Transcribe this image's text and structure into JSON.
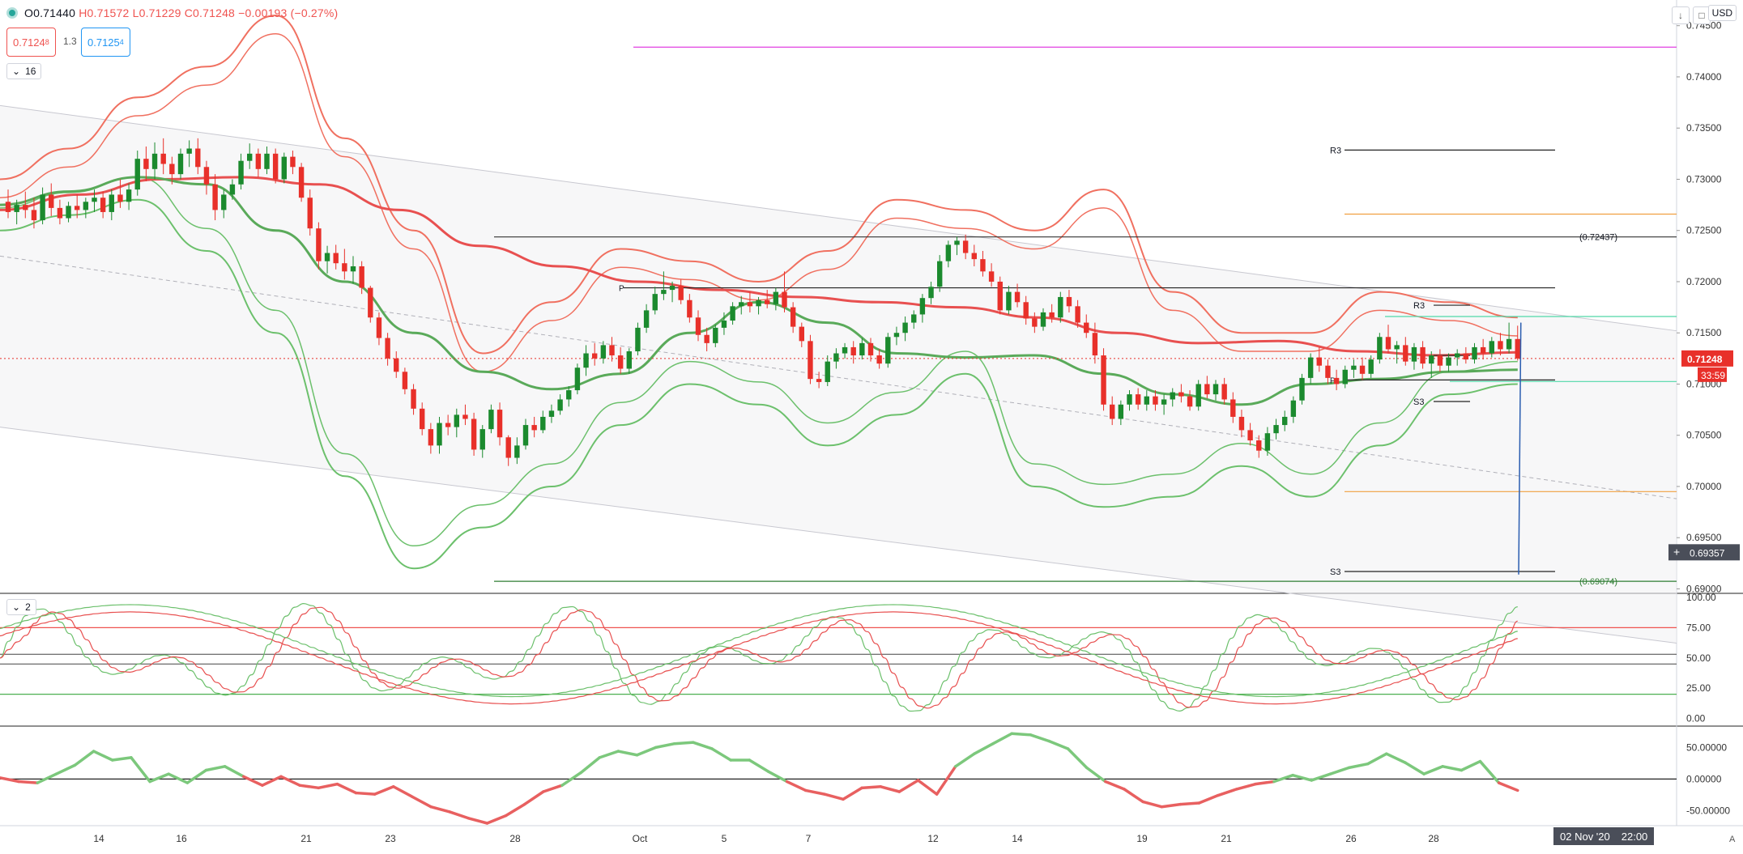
{
  "header": {
    "ohlc_open": "O0.71440",
    "ohlc_high": "H0.71572",
    "ohlc_low": "L0.71229",
    "ohlc_close": "C0.71248",
    "ohlc_change": "−0.00193 (−0.27%)",
    "sell_price": "0.7124",
    "sell_price_sup": "8",
    "spread": "1.3",
    "buy_price": "0.7125",
    "buy_price_sup": "4",
    "indicator_count_main": "16",
    "indicator_count_sub": "2",
    "currency": "USD"
  },
  "colors": {
    "up": "#1b8a2e",
    "down": "#e8302a",
    "bb_upper": "#f07060",
    "bb_lower": "#6cc06c",
    "ma_slow": "#e85050",
    "ma_fast": "#5aaa5a",
    "magenta": "#e040e0",
    "orange": "#f0a040",
    "mint": "#50d8a8",
    "trend_blue": "#2a5db0",
    "price_tag": "#e8302a",
    "crosshair_tag": "#4a4e59"
  },
  "price_axis": {
    "ticks": [
      "0.74500",
      "0.74000",
      "0.73500",
      "0.73000",
      "0.72500",
      "0.72000",
      "0.71500",
      "0.71000",
      "0.70500",
      "0.70000",
      "0.69500",
      "0.69000"
    ],
    "current_price": "0.71248",
    "countdown": "33:59",
    "crosshair_price": "0.69357"
  },
  "stoch_axis": {
    "ticks": [
      "100.00",
      "75.00",
      "50.00",
      "25.00",
      "0.00"
    ]
  },
  "mom_axis": {
    "ticks": [
      "50.00000",
      "0.00000",
      "-50.00000"
    ]
  },
  "time_axis": {
    "labels": [
      "14",
      "16",
      "21",
      "23",
      "28",
      "Oct",
      "5",
      "7",
      "12",
      "14",
      "19",
      "21",
      "26",
      "28"
    ],
    "tail": "4",
    "crosshair_date": "02 Nov '20",
    "crosshair_time": "22:00"
  },
  "annotations": {
    "fib_high": "(0.72437)",
    "fib_low": "(0.69074)",
    "r3_weekly": "R3",
    "s3_weekly": "S3",
    "r3_daily": "R3",
    "s3_daily": "S3",
    "p_label": "P",
    "p_label2": "P"
  },
  "chart_data": {
    "type": "candlestick",
    "symbol_pair": "AUD/USD",
    "ylim": [
      0.6898,
      0.7464
    ],
    "candles": [
      [
        0.7278,
        0.729,
        0.7262,
        0.7268
      ],
      [
        0.7268,
        0.728,
        0.7256,
        0.7275
      ],
      [
        0.7275,
        0.7288,
        0.7262,
        0.727
      ],
      [
        0.727,
        0.7282,
        0.7252,
        0.726
      ],
      [
        0.726,
        0.7292,
        0.7256,
        0.7285
      ],
      [
        0.7285,
        0.7296,
        0.7264,
        0.7272
      ],
      [
        0.7272,
        0.728,
        0.7256,
        0.7262
      ],
      [
        0.7262,
        0.7278,
        0.7258,
        0.7274
      ],
      [
        0.7274,
        0.7285,
        0.7262,
        0.727
      ],
      [
        0.727,
        0.7282,
        0.7262,
        0.7278
      ],
      [
        0.7278,
        0.729,
        0.7268,
        0.7282
      ],
      [
        0.7282,
        0.7288,
        0.7262,
        0.7268
      ],
      [
        0.7268,
        0.729,
        0.726,
        0.7285
      ],
      [
        0.7285,
        0.73,
        0.7272,
        0.7278
      ],
      [
        0.7278,
        0.7296,
        0.727,
        0.729
      ],
      [
        0.729,
        0.7328,
        0.7284,
        0.732
      ],
      [
        0.732,
        0.7332,
        0.7298,
        0.731
      ],
      [
        0.731,
        0.7336,
        0.73,
        0.7325
      ],
      [
        0.7325,
        0.734,
        0.7305,
        0.7315
      ],
      [
        0.7315,
        0.7322,
        0.7295,
        0.7305
      ],
      [
        0.7305,
        0.733,
        0.73,
        0.7325
      ],
      [
        0.7325,
        0.7338,
        0.7312,
        0.733
      ],
      [
        0.733,
        0.734,
        0.7305,
        0.7312
      ],
      [
        0.7312,
        0.7318,
        0.7285,
        0.7295
      ],
      [
        0.7295,
        0.7305,
        0.726,
        0.727
      ],
      [
        0.727,
        0.729,
        0.7262,
        0.7285
      ],
      [
        0.7285,
        0.73,
        0.728,
        0.7295
      ],
      [
        0.7295,
        0.7325,
        0.729,
        0.7318
      ],
      [
        0.7318,
        0.7335,
        0.731,
        0.7325
      ],
      [
        0.7325,
        0.733,
        0.7302,
        0.731
      ],
      [
        0.731,
        0.7332,
        0.7305,
        0.7325
      ],
      [
        0.7325,
        0.733,
        0.7296,
        0.73
      ],
      [
        0.73,
        0.7326,
        0.7296,
        0.7322
      ],
      [
        0.7322,
        0.7328,
        0.7305,
        0.7312
      ],
      [
        0.7312,
        0.7316,
        0.7278,
        0.7282
      ],
      [
        0.7282,
        0.729,
        0.7245,
        0.7252
      ],
      [
        0.7252,
        0.7258,
        0.7212,
        0.722
      ],
      [
        0.722,
        0.7235,
        0.7208,
        0.7228
      ],
      [
        0.7228,
        0.7236,
        0.7212,
        0.7218
      ],
      [
        0.7218,
        0.7232,
        0.7202,
        0.721
      ],
      [
        0.721,
        0.7225,
        0.7198,
        0.7215
      ],
      [
        0.7215,
        0.722,
        0.7188,
        0.7194
      ],
      [
        0.7194,
        0.7196,
        0.716,
        0.7165
      ],
      [
        0.7165,
        0.717,
        0.7138,
        0.7145
      ],
      [
        0.7145,
        0.715,
        0.7118,
        0.7125
      ],
      [
        0.7125,
        0.7132,
        0.7106,
        0.7112
      ],
      [
        0.7112,
        0.7116,
        0.709,
        0.7095
      ],
      [
        0.7095,
        0.71,
        0.707,
        0.7076
      ],
      [
        0.7076,
        0.7082,
        0.705,
        0.7056
      ],
      [
        0.7056,
        0.7062,
        0.7032,
        0.704
      ],
      [
        0.704,
        0.7068,
        0.7032,
        0.7062
      ],
      [
        0.7062,
        0.707,
        0.705,
        0.7058
      ],
      [
        0.7058,
        0.7076,
        0.7048,
        0.707
      ],
      [
        0.707,
        0.708,
        0.706,
        0.7066
      ],
      [
        0.7066,
        0.7072,
        0.703,
        0.7036
      ],
      [
        0.7036,
        0.706,
        0.7028,
        0.7056
      ],
      [
        0.7056,
        0.708,
        0.7052,
        0.7075
      ],
      [
        0.7075,
        0.7082,
        0.704,
        0.7048
      ],
      [
        0.7048,
        0.705,
        0.702,
        0.7028
      ],
      [
        0.7028,
        0.7048,
        0.7022,
        0.704
      ],
      [
        0.704,
        0.7066,
        0.7036,
        0.706
      ],
      [
        0.706,
        0.7068,
        0.7048,
        0.7055
      ],
      [
        0.7055,
        0.7074,
        0.7052,
        0.7068
      ],
      [
        0.7068,
        0.708,
        0.7062,
        0.7074
      ],
      [
        0.7074,
        0.709,
        0.707,
        0.7085
      ],
      [
        0.7085,
        0.7098,
        0.7078,
        0.7094
      ],
      [
        0.7094,
        0.712,
        0.709,
        0.7116
      ],
      [
        0.7116,
        0.7138,
        0.7108,
        0.713
      ],
      [
        0.713,
        0.714,
        0.7118,
        0.7125
      ],
      [
        0.7125,
        0.7142,
        0.712,
        0.7138
      ],
      [
        0.7138,
        0.7146,
        0.7122,
        0.7128
      ],
      [
        0.7128,
        0.7136,
        0.711,
        0.7115
      ],
      [
        0.7115,
        0.7135,
        0.711,
        0.7132
      ],
      [
        0.7132,
        0.716,
        0.7128,
        0.7155
      ],
      [
        0.7155,
        0.7178,
        0.715,
        0.7172
      ],
      [
        0.7172,
        0.7195,
        0.7168,
        0.7188
      ],
      [
        0.7188,
        0.721,
        0.7182,
        0.7192
      ],
      [
        0.7192,
        0.72,
        0.718,
        0.7196
      ],
      [
        0.7196,
        0.7202,
        0.7178,
        0.7182
      ],
      [
        0.7182,
        0.7188,
        0.716,
        0.7165
      ],
      [
        0.7165,
        0.7172,
        0.7142,
        0.7148
      ],
      [
        0.7148,
        0.7155,
        0.7132,
        0.714
      ],
      [
        0.714,
        0.7158,
        0.7136,
        0.7155
      ],
      [
        0.7155,
        0.717,
        0.7148,
        0.7162
      ],
      [
        0.7162,
        0.718,
        0.7158,
        0.7176
      ],
      [
        0.7176,
        0.7186,
        0.7168,
        0.718
      ],
      [
        0.718,
        0.719,
        0.717,
        0.7176
      ],
      [
        0.7176,
        0.7185,
        0.7168,
        0.7182
      ],
      [
        0.7182,
        0.7192,
        0.7174,
        0.7178
      ],
      [
        0.7178,
        0.7194,
        0.7172,
        0.719
      ],
      [
        0.719,
        0.721,
        0.717,
        0.7175
      ],
      [
        0.7175,
        0.718,
        0.715,
        0.7156
      ],
      [
        0.7156,
        0.716,
        0.7136,
        0.7142
      ],
      [
        0.7142,
        0.7148,
        0.71,
        0.7105
      ],
      [
        0.7105,
        0.7112,
        0.7096,
        0.7102
      ],
      [
        0.7102,
        0.7128,
        0.7098,
        0.7122
      ],
      [
        0.7122,
        0.7135,
        0.7115,
        0.713
      ],
      [
        0.713,
        0.714,
        0.7125,
        0.7136
      ],
      [
        0.7136,
        0.7142,
        0.712,
        0.7128
      ],
      [
        0.7128,
        0.7145,
        0.7124,
        0.714
      ],
      [
        0.714,
        0.7145,
        0.7122,
        0.7128
      ],
      [
        0.7128,
        0.7134,
        0.7115,
        0.712
      ],
      [
        0.712,
        0.715,
        0.7116,
        0.7146
      ],
      [
        0.7146,
        0.7156,
        0.7138,
        0.715
      ],
      [
        0.715,
        0.7166,
        0.7142,
        0.716
      ],
      [
        0.716,
        0.7172,
        0.7154,
        0.7168
      ],
      [
        0.7168,
        0.7188,
        0.716,
        0.7184
      ],
      [
        0.7184,
        0.72,
        0.7178,
        0.7195
      ],
      [
        0.7195,
        0.7226,
        0.719,
        0.722
      ],
      [
        0.722,
        0.724,
        0.7214,
        0.7236
      ],
      [
        0.7236,
        0.7244,
        0.7226,
        0.724
      ],
      [
        0.724,
        0.7246,
        0.7222,
        0.7228
      ],
      [
        0.7228,
        0.7236,
        0.7215,
        0.7222
      ],
      [
        0.7222,
        0.723,
        0.7205,
        0.721
      ],
      [
        0.721,
        0.7218,
        0.7195,
        0.72
      ],
      [
        0.72,
        0.7205,
        0.7168,
        0.7172
      ],
      [
        0.7172,
        0.7196,
        0.7168,
        0.719
      ],
      [
        0.719,
        0.7198,
        0.7175,
        0.718
      ],
      [
        0.718,
        0.7186,
        0.7158,
        0.7164
      ],
      [
        0.7164,
        0.717,
        0.715,
        0.7156
      ],
      [
        0.7156,
        0.7174,
        0.7152,
        0.717
      ],
      [
        0.717,
        0.7178,
        0.716,
        0.7165
      ],
      [
        0.7165,
        0.719,
        0.716,
        0.7185
      ],
      [
        0.7185,
        0.7192,
        0.717,
        0.7176
      ],
      [
        0.7176,
        0.7182,
        0.7155,
        0.716
      ],
      [
        0.716,
        0.7168,
        0.7145,
        0.715
      ],
      [
        0.715,
        0.716,
        0.712,
        0.7128
      ],
      [
        0.7128,
        0.7135,
        0.7074,
        0.708
      ],
      [
        0.708,
        0.7088,
        0.706,
        0.7066
      ],
      [
        0.7066,
        0.7084,
        0.706,
        0.708
      ],
      [
        0.708,
        0.7094,
        0.7074,
        0.709
      ],
      [
        0.709,
        0.7096,
        0.7075,
        0.708
      ],
      [
        0.708,
        0.7094,
        0.7074,
        0.7088
      ],
      [
        0.7088,
        0.7094,
        0.7074,
        0.708
      ],
      [
        0.708,
        0.709,
        0.707,
        0.7085
      ],
      [
        0.7085,
        0.7096,
        0.7078,
        0.7092
      ],
      [
        0.7092,
        0.71,
        0.7082,
        0.7088
      ],
      [
        0.7088,
        0.7094,
        0.7074,
        0.7078
      ],
      [
        0.7078,
        0.7104,
        0.7074,
        0.71
      ],
      [
        0.71,
        0.7108,
        0.7086,
        0.709
      ],
      [
        0.709,
        0.7104,
        0.7084,
        0.71
      ],
      [
        0.71,
        0.7106,
        0.708,
        0.7085
      ],
      [
        0.7085,
        0.7092,
        0.7062,
        0.7068
      ],
      [
        0.7068,
        0.7075,
        0.7048,
        0.7055
      ],
      [
        0.7055,
        0.7062,
        0.704,
        0.7045
      ],
      [
        0.7045,
        0.705,
        0.7028,
        0.7035
      ],
      [
        0.7035,
        0.7058,
        0.703,
        0.7052
      ],
      [
        0.7052,
        0.7066,
        0.7046,
        0.706
      ],
      [
        0.706,
        0.7074,
        0.7054,
        0.7068
      ],
      [
        0.7068,
        0.7088,
        0.7062,
        0.7084
      ],
      [
        0.7084,
        0.711,
        0.708,
        0.7106
      ],
      [
        0.7106,
        0.713,
        0.71,
        0.7126
      ],
      [
        0.7126,
        0.7136,
        0.7112,
        0.7118
      ],
      [
        0.7118,
        0.7124,
        0.71,
        0.7106
      ],
      [
        0.7106,
        0.7114,
        0.7094,
        0.71
      ],
      [
        0.71,
        0.7118,
        0.7096,
        0.7114
      ],
      [
        0.7114,
        0.7124,
        0.7106,
        0.7118
      ],
      [
        0.7118,
        0.7126,
        0.7104,
        0.711
      ],
      [
        0.711,
        0.7128,
        0.7106,
        0.7124
      ],
      [
        0.7124,
        0.715,
        0.712,
        0.7146
      ],
      [
        0.7146,
        0.7158,
        0.713,
        0.7134
      ],
      [
        0.7134,
        0.7142,
        0.712,
        0.7138
      ],
      [
        0.7138,
        0.7146,
        0.7118,
        0.7122
      ],
      [
        0.7122,
        0.714,
        0.7114,
        0.7136
      ],
      [
        0.7136,
        0.7142,
        0.7115,
        0.712
      ],
      [
        0.712,
        0.7132,
        0.7106,
        0.7128
      ],
      [
        0.7128,
        0.7134,
        0.7112,
        0.7118
      ],
      [
        0.7118,
        0.713,
        0.7112,
        0.7126
      ],
      [
        0.7126,
        0.7134,
        0.7118,
        0.713
      ],
      [
        0.713,
        0.7136,
        0.712,
        0.7124
      ],
      [
        0.7124,
        0.714,
        0.712,
        0.7136
      ],
      [
        0.7136,
        0.7144,
        0.7124,
        0.713
      ],
      [
        0.713,
        0.7146,
        0.7126,
        0.7142
      ],
      [
        0.7142,
        0.715,
        0.7128,
        0.7134
      ],
      [
        0.7134,
        0.716,
        0.713,
        0.7144
      ],
      [
        0.7144,
        0.7157,
        0.7123,
        0.7125
      ]
    ],
    "ma_slow": [
      0.727,
      0.7285,
      0.73,
      0.7302,
      0.7295,
      0.727,
      0.7235,
      0.7215,
      0.72,
      0.7192,
      0.7185,
      0.718,
      0.7175,
      0.7165,
      0.715,
      0.714,
      0.7142,
      0.7132,
      0.7128,
      0.7131
    ],
    "ma_fast": [
      0.7275,
      0.7288,
      0.7302,
      0.7295,
      0.725,
      0.72,
      0.715,
      0.7112,
      0.7095,
      0.711,
      0.715,
      0.718,
      0.716,
      0.713,
      0.7126,
      0.7128,
      0.711,
      0.709,
      0.708,
      0.71,
      0.7105,
      0.7112,
      0.7114
    ],
    "bb_upper": [
      0.73,
      0.733,
      0.738,
      0.741,
      0.746,
      0.734,
      0.725,
      0.713,
      0.718,
      0.7232,
      0.722,
      0.72,
      0.723,
      0.728,
      0.727,
      0.725,
      0.729,
      0.719,
      0.715,
      0.715,
      0.719,
      0.718,
      0.7165
    ],
    "bb_lower": [
      0.725,
      0.7265,
      0.728,
      0.723,
      0.715,
      0.701,
      0.692,
      0.696,
      0.7,
      0.706,
      0.71,
      0.708,
      0.704,
      0.707,
      0.711,
      0.7,
      0.698,
      0.699,
      0.702,
      0.699,
      0.704,
      0.709,
      0.71
    ],
    "levels": {
      "fib_high": 0.72437,
      "fib_low": 0.69074,
      "r3_weekly": 0.73285,
      "s3_weekly": 0.6917,
      "magenta": 0.7429,
      "orange_top": 0.7266,
      "orange_bottom": 0.6995,
      "upper_swing_line": 0.7194,
      "r3_daily": 0.7177,
      "mint": 0.7166,
      "pivot_daily": 0.7128,
      "pivot_black": 0.7104,
      "mint_low": 0.71025,
      "s3_daily": 0.7083
    },
    "stochastic": {
      "ylim": [
        -5,
        100
      ],
      "bands": [
        75,
        53,
        45,
        20
      ]
    },
    "momentum": {
      "ylim": [
        -70,
        80
      ],
      "values": [
        2,
        -4,
        -6,
        8,
        22,
        44,
        30,
        34,
        -4,
        8,
        -6,
        14,
        20,
        4,
        -10,
        4,
        -10,
        -14,
        -8,
        -22,
        -24,
        -12,
        -28,
        -44,
        -52,
        -62,
        -70,
        -58,
        -40,
        -20,
        -10,
        10,
        34,
        44,
        38,
        50,
        56,
        58,
        48,
        30,
        30,
        12,
        -4,
        -18,
        -24,
        -32,
        -14,
        -12,
        -20,
        -2,
        -24,
        20,
        40,
        56,
        72,
        70,
        60,
        48,
        18,
        -4,
        -16,
        -36,
        -44,
        -40,
        -38,
        -26,
        -16,
        -8,
        -4,
        6,
        -2,
        8,
        18,
        24,
        40,
        26,
        8,
        20,
        14,
        28,
        -6,
        -18
      ]
    }
  }
}
